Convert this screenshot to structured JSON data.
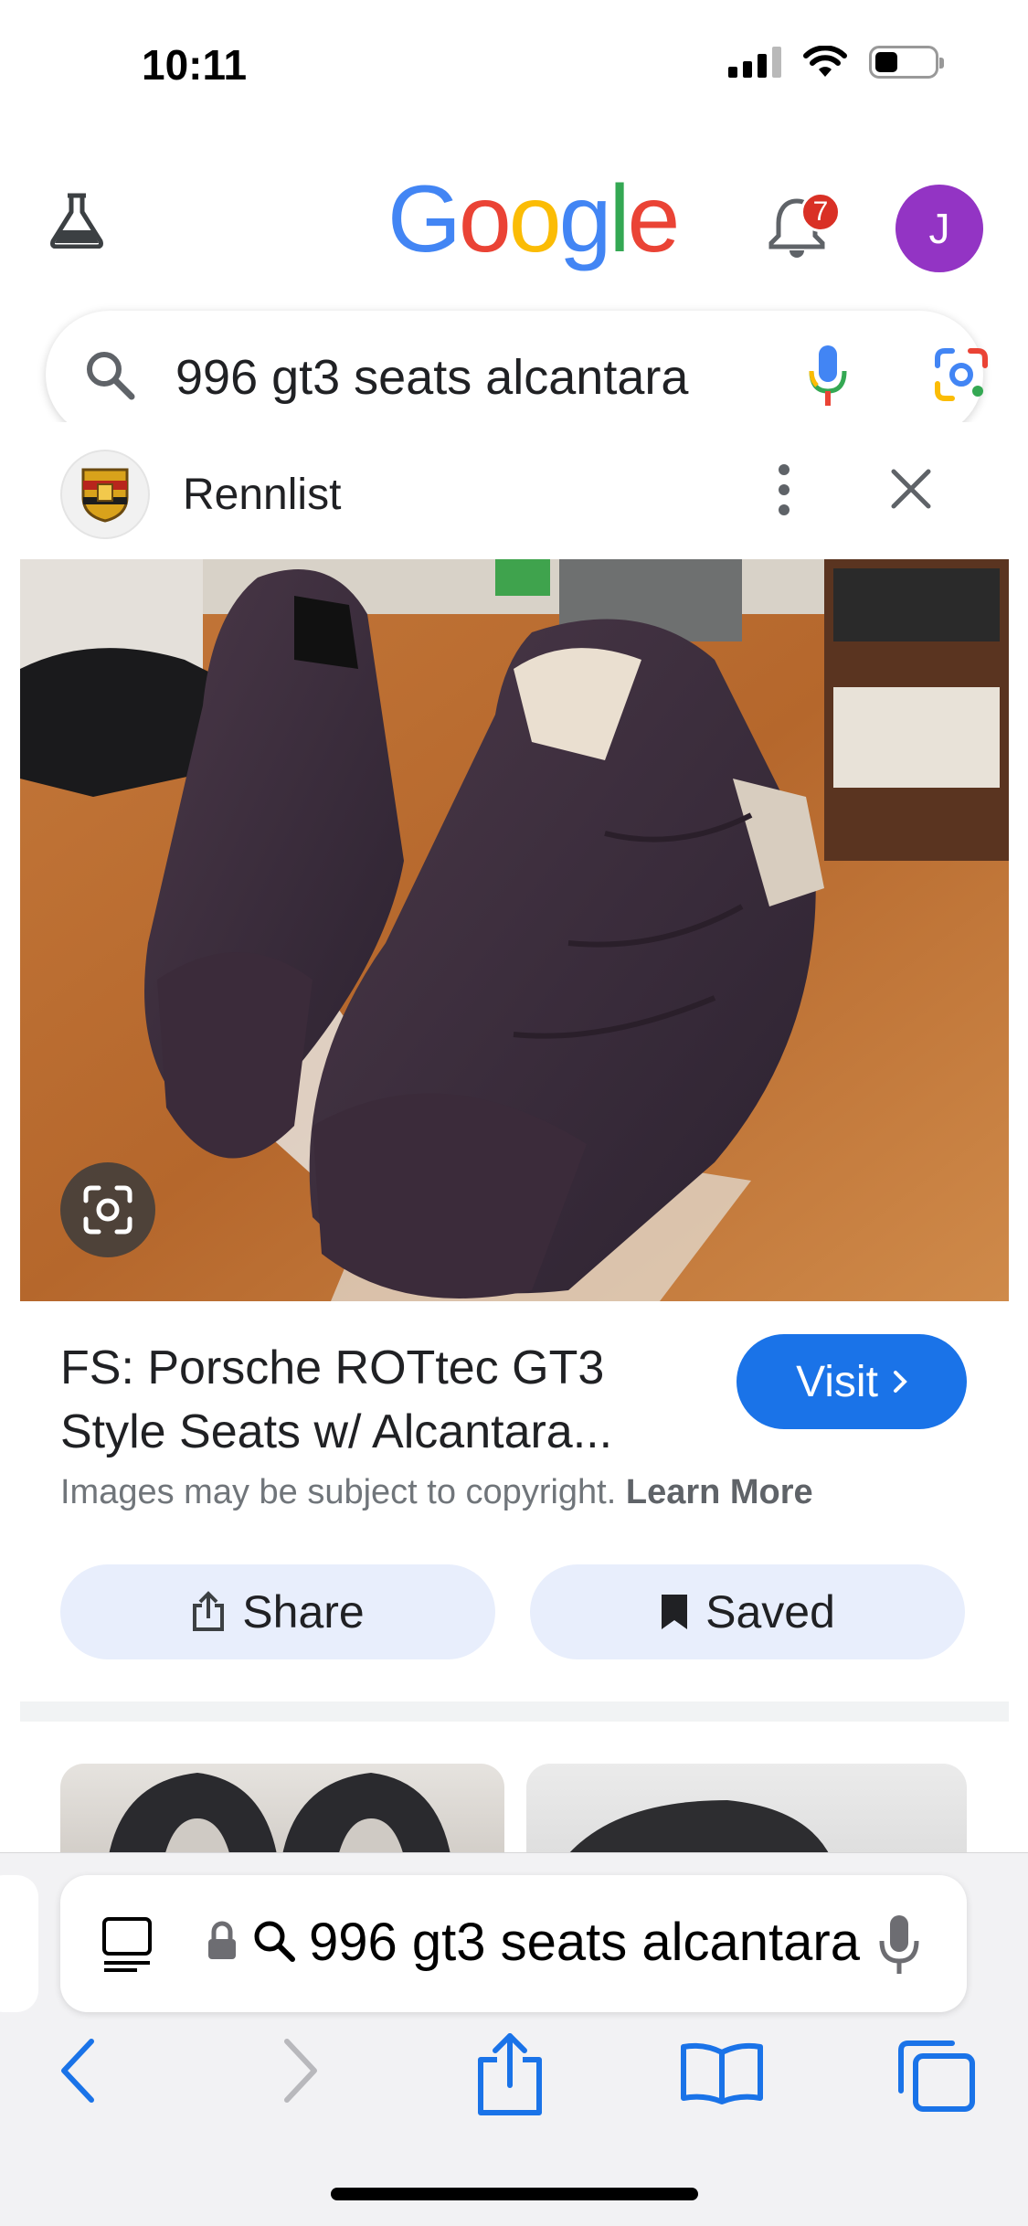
{
  "status_bar": {
    "time": "10:11"
  },
  "google_header": {
    "logo_letters": [
      {
        "char": "G",
        "color": "#4285F4"
      },
      {
        "char": "o",
        "color": "#EA4335"
      },
      {
        "char": "o",
        "color": "#FBBC05"
      },
      {
        "char": "g",
        "color": "#4285F4"
      },
      {
        "char": "l",
        "color": "#34A853"
      },
      {
        "char": "e",
        "color": "#EA4335"
      }
    ],
    "notification_count": "7",
    "avatar_initial": "J",
    "avatar_color": "#9334c4"
  },
  "search": {
    "query": "996 gt3 seats alcantara"
  },
  "result_panel": {
    "source_name": "Rennlist",
    "title": "FS: Porsche ROTtec GT3 Style Seats w/ Alcantara...",
    "visit_label": "Visit",
    "copyright_text": "Images may be subject to copyright.",
    "learn_more": "Learn More",
    "share_label": "Share",
    "saved_label": "Saved",
    "accent_color": "#1a73e8"
  },
  "safari": {
    "url_text": "996 gt3 seats alcantara"
  },
  "icons": {
    "labs": "flask-icon",
    "notifications": "bell-icon",
    "search": "search-icon",
    "voice": "mic-icon",
    "lens": "lens-icon",
    "more": "more-vert-icon",
    "close": "close-icon",
    "share": "share-icon",
    "saved": "bookmark-icon",
    "back": "back-icon",
    "forward": "forward-icon",
    "tabs": "tabs-icon"
  }
}
